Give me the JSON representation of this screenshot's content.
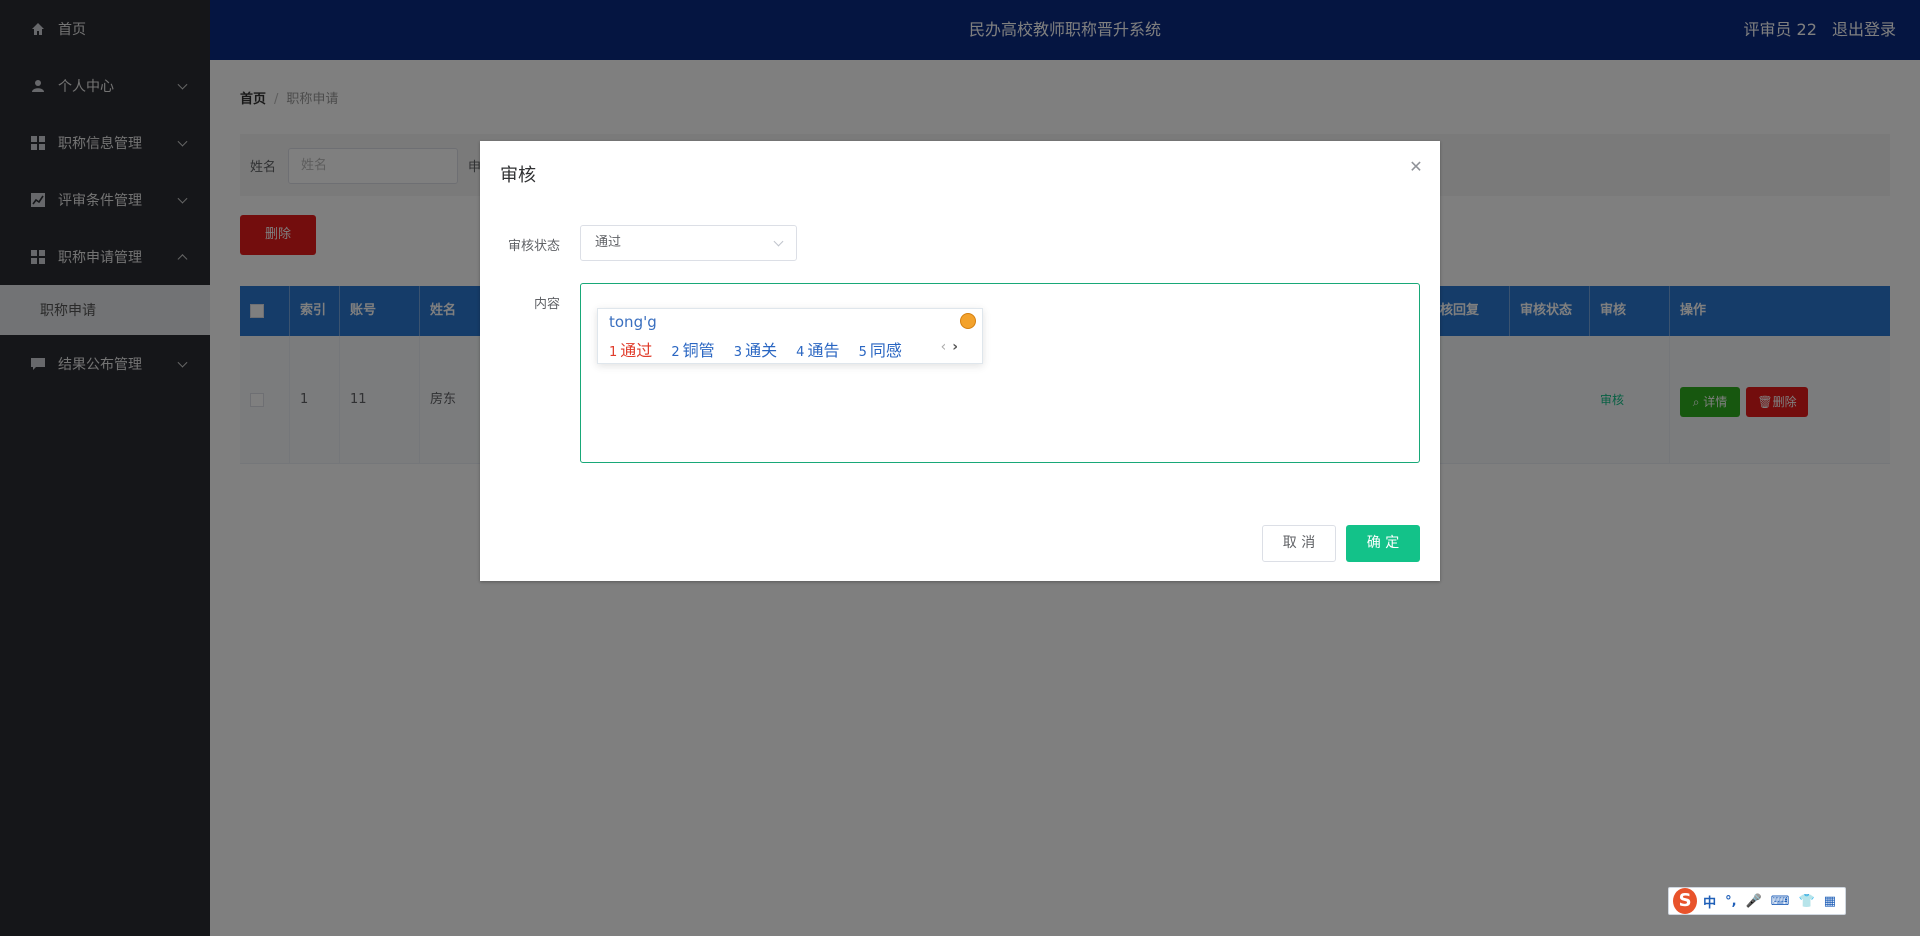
{
  "app": {
    "title": "民办高校教师职称晋升系统",
    "user": "评审员 22",
    "logout": "退出登录"
  },
  "sidebar": {
    "items": [
      {
        "label": "首页",
        "icon": "home-icon"
      },
      {
        "label": "个人中心",
        "icon": "user-icon"
      },
      {
        "label": "职称信息管理",
        "icon": "grid-icon"
      },
      {
        "label": "评审条件管理",
        "icon": "chart-icon"
      },
      {
        "label": "职称申请管理",
        "icon": "grid-icon"
      },
      {
        "label": "结果公布管理",
        "icon": "message-icon"
      }
    ],
    "active_sub": "职称申请"
  },
  "breadcrumb": {
    "home": "首页",
    "current": "职称申请"
  },
  "search": {
    "name_label": "姓名",
    "name_placeholder": "姓名",
    "label2": "申"
  },
  "toolbar": {
    "delete_label": "删除"
  },
  "table": {
    "headers": [
      "索引",
      "账号",
      "姓名",
      "核回复",
      "审核状态",
      "审核",
      "操作"
    ],
    "row": {
      "index": "1",
      "account": "11",
      "name": "房东",
      "audit_link": "审核",
      "detail_label": "详情",
      "delete_label": "删除"
    }
  },
  "dialog": {
    "title": "审核",
    "status_label": "审核状态",
    "status_value": "通过",
    "content_label": "内容",
    "cancel_label": "取 消",
    "ok_label": "确 定",
    "ime": {
      "pinyin": "tong'g",
      "candidates": [
        {
          "n": "1",
          "text": "通过"
        },
        {
          "n": "2",
          "text": "铜管"
        },
        {
          "n": "3",
          "text": "通关"
        },
        {
          "n": "4",
          "text": "通告"
        },
        {
          "n": "5",
          "text": "同感"
        }
      ],
      "prev": "‹",
      "next": "›"
    }
  },
  "ime_toolbar": {
    "logo": "S",
    "items": [
      "中",
      "°,",
      "🎤",
      "⌨",
      "👕",
      "▦"
    ]
  },
  "colors": {
    "header": "#0b2a82",
    "sidebar": "#2b2d33",
    "primary": "#13c289",
    "danger": "#e61b1b",
    "table_head": "#2b78d2"
  }
}
